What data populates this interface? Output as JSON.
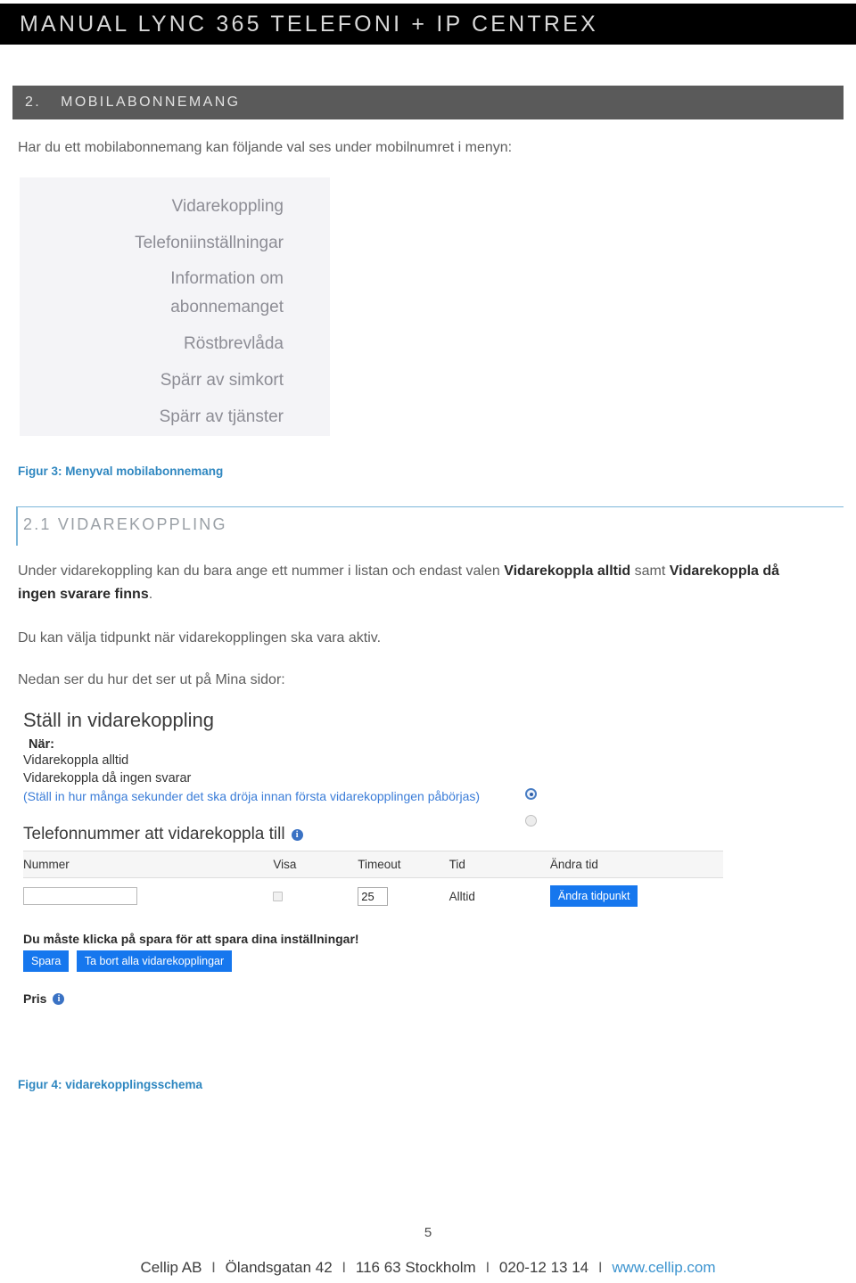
{
  "banner": {
    "title": "MANUAL LYNC 365 TELEFONI + IP CENTREX",
    "background": "#000000",
    "text_color": "#d8d8d8"
  },
  "section": {
    "number": "2.",
    "title": "MOBILABONNEMANG",
    "background": "#5a5a5a"
  },
  "intro_paragraph": "Har du ett mobilabonnemang kan följande val ses under mobilnumret i menyn:",
  "figure3": {
    "caption": "Figur 3: Menyval mobilabonnemang",
    "caption_color": "#2f87c0",
    "menu_items": [
      "Vidarekoppling",
      "Telefoniinställningar",
      "Information om\nabonnemanget",
      "Röstbrevlåda",
      "Spärr av simkort",
      "Spärr av tjänster"
    ]
  },
  "subsection": {
    "number": "2.1",
    "title": "VIDAREKOPPLING",
    "heading_full": "2.1 VIDAREKOPPLING",
    "accent_color": "#7cb6d9"
  },
  "body": {
    "p1_part1": "Under vidarekoppling kan du bara ange ett nummer i listan och endast valen ",
    "p1_bold1": "Vidarekoppla alltid",
    "p1_part2": " samt ",
    "p1_bold2": "Vidarekoppla då ingen svarare finns",
    "p1_part3": ".",
    "p2": "Du kan välja tidpunkt när vidarekopplingen ska vara aktiv.",
    "p3": "Nedan ser du hur det ser ut på Mina sidor:"
  },
  "figure4": {
    "caption": "Figur 4: vidarekopplingsschema",
    "form_title": "Ställ in vidarekoppling",
    "nar_label": "När:",
    "option_always": "Vidarekoppla alltid",
    "option_noanswer": "Vidarekoppla då ingen svarar",
    "option_hint": "(Ställ in hur många sekunder det ska dröja innan första vidarekopplingen påbörjas)",
    "selected_option": "Vidarekoppla alltid",
    "tel_heading": "Telefonnummer att vidarekoppla till",
    "table": {
      "headers": [
        "Nummer",
        "Visa",
        "Timeout",
        "Tid",
        "Ändra tid"
      ],
      "rows": [
        {
          "nummer_value": "",
          "visa_checked": false,
          "timeout_value": "25",
          "tid_value": "Alltid",
          "andra_tid_button": "Ändra tidpunkt"
        }
      ]
    },
    "save_note": "Du måste klicka på spara för att spara dina inställningar!",
    "save_button": "Spara",
    "delete_all_button": "Ta bort alla vidarekopplingar",
    "pris_label": "Pris",
    "button_color": "#1677ee",
    "info_icon_color": "#3a72c4"
  },
  "footer": {
    "page_number": "5",
    "company": "Cellip AB",
    "address": "Ölandsgatan 42",
    "city": "116 63 Stockholm",
    "phone": "020-12 13 14",
    "website": "www.cellip.com",
    "separator": "I",
    "url_color": "#3b93cf"
  }
}
